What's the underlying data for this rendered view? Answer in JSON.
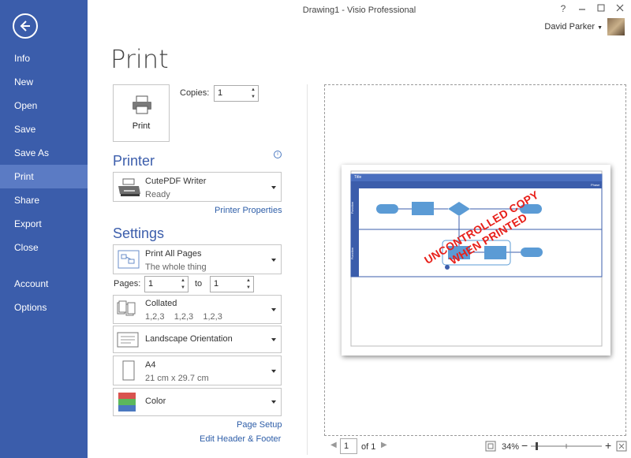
{
  "window": {
    "title": "Drawing1 - Visio Professional",
    "help": "?",
    "user_name": "David Parker"
  },
  "sidebar": {
    "items": [
      {
        "label": "Info"
      },
      {
        "label": "New"
      },
      {
        "label": "Open"
      },
      {
        "label": "Save"
      },
      {
        "label": "Save As"
      },
      {
        "label": "Print"
      },
      {
        "label": "Share"
      },
      {
        "label": "Export"
      },
      {
        "label": "Close"
      },
      {
        "label": "Account"
      },
      {
        "label": "Options"
      }
    ],
    "active": "Print"
  },
  "page": {
    "title": "Print",
    "print_button": "Print",
    "copies_label": "Copies:",
    "copies_value": "1"
  },
  "printer": {
    "heading": "Printer",
    "name": "CutePDF Writer",
    "status": "Ready",
    "properties_link": "Printer Properties"
  },
  "settings": {
    "heading": "Settings",
    "pages_dropdown": {
      "title": "Print All Pages",
      "subtitle": "The whole thing"
    },
    "pages_label": "Pages:",
    "pages_from": "1",
    "to_label": "to",
    "pages_to": "1",
    "collation": {
      "title": "Collated",
      "subtitle": "1,2,3    1,2,3    1,2,3"
    },
    "orientation": {
      "title": "Landscape Orientation"
    },
    "paper": {
      "title": "A4",
      "subtitle": "21 cm x 29.7 cm"
    },
    "color": {
      "title": "Color"
    },
    "page_setup_link": "Page Setup",
    "header_footer_link": "Edit Header & Footer"
  },
  "preview": {
    "watermark_line1": "UNCONTROLLED COPY",
    "watermark_line2": "WHEN PRINTED",
    "diagram_title": "Title",
    "diagram_phase": "Phase",
    "lane1": "Function",
    "lane2": "Function",
    "current_page": "1",
    "of_pages": "of 1",
    "zoom": "34%",
    "colors": {
      "accent": "#3b5dab",
      "shape": "#5b9bd5",
      "watermark": "#e8201a"
    }
  }
}
